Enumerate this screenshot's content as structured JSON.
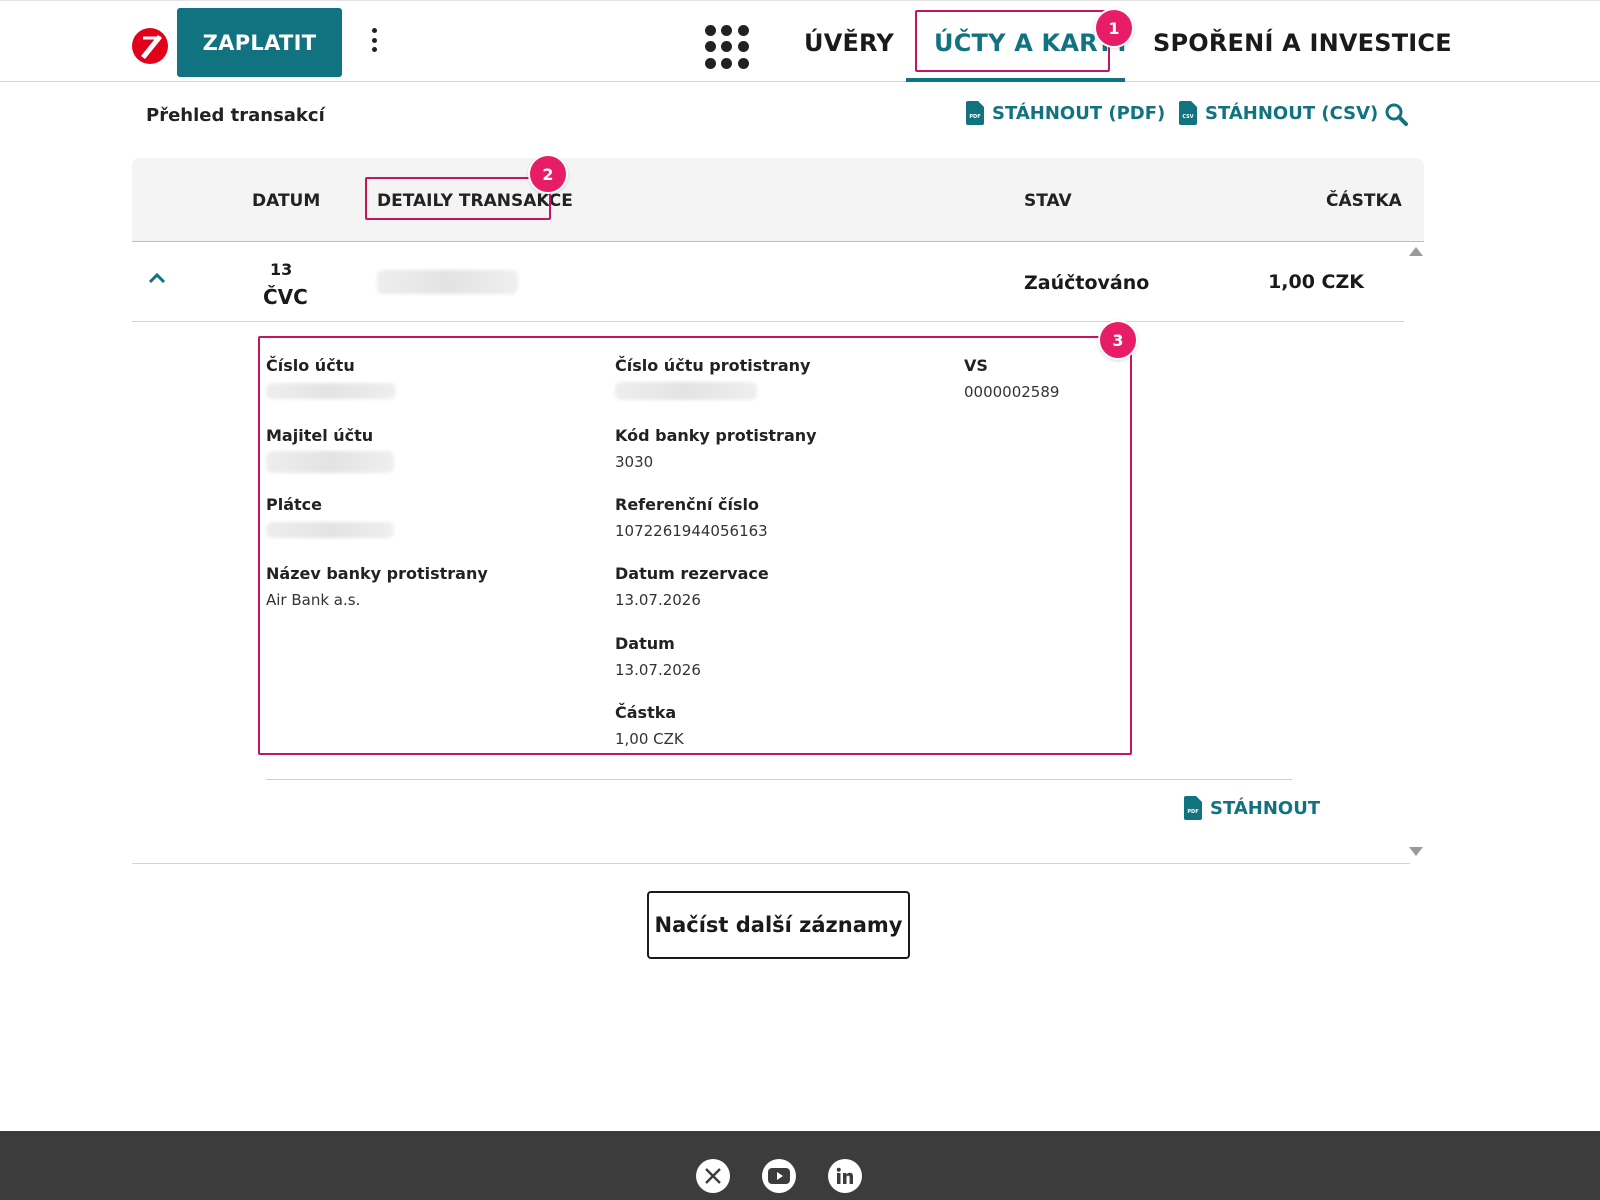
{
  "header": {
    "pay_label": "ZAPLATIT",
    "nav": [
      "ÚVĚRY",
      "ÚČTY A KARTY",
      "SPOŘENÍ A INVESTICE"
    ],
    "active_nav": "ÚČTY A KARTY",
    "accent_color": "#11737f"
  },
  "annotations": [
    "1",
    "2",
    "3"
  ],
  "toolbar": {
    "title": "Přehled transakcí",
    "download_pdf": "STÁHNOUT (PDF)",
    "download_csv": "STÁHNOUT (CSV)",
    "pdf_icon_text": "PDF",
    "csv_icon_text": "CSV"
  },
  "table": {
    "headers": [
      "DATUM",
      "DETAILY TRANSAKCE",
      "STAV",
      "ČÁSTKA"
    ],
    "row": {
      "day": "13",
      "month": "ČVC",
      "status": "Zaúčtováno",
      "amount": "1,00 CZK"
    }
  },
  "details": {
    "col1": [
      {
        "label": "Číslo účtu",
        "value": ""
      },
      {
        "label": "Majitel účtu",
        "value": ""
      },
      {
        "label": "Plátce",
        "value": ""
      },
      {
        "label": "Název banky protistrany",
        "value": "Air Bank a.s."
      }
    ],
    "col2": [
      {
        "label": "Číslo účtu protistrany",
        "value": ""
      },
      {
        "label": "Kód banky protistrany",
        "value": "3030"
      },
      {
        "label": "Referenční číslo",
        "value": "1072261944056163"
      },
      {
        "label": "Datum rezervace",
        "value": "13.07.2026"
      },
      {
        "label": "Datum",
        "value": "13.07.2026"
      },
      {
        "label": "Částka",
        "value": "1,00 CZK"
      }
    ],
    "col3": [
      {
        "label": "VS",
        "value": "0000002589"
      }
    ],
    "download_label": "STÁHNOUT"
  },
  "load_more": "Načíst další záznamy",
  "footer": {
    "social": [
      "x-icon",
      "youtube-icon",
      "linkedin-icon"
    ]
  }
}
